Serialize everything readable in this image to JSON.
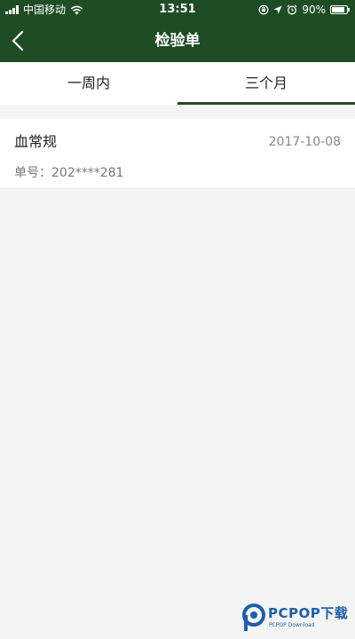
{
  "status_bar": {
    "carrier": "中国移动",
    "time": "13:51",
    "battery_percent": "90%",
    "battery_level": 0.9,
    "icons": [
      "signal-icon",
      "wifi-icon",
      "lock-rotation-icon",
      "location-icon",
      "alarm-icon",
      "battery-icon"
    ]
  },
  "nav": {
    "title": "检验单",
    "back_icon": "back-chevron-icon"
  },
  "tabs": [
    {
      "label": "一周内",
      "active": false
    },
    {
      "label": "三个月",
      "active": true
    }
  ],
  "records": [
    {
      "name": "血常规",
      "date": "2017-10-08",
      "number_label": "单号：",
      "number_value": "202****281"
    }
  ],
  "watermark": {
    "text": "PCPOP下载",
    "sub": "PCPOP Download"
  },
  "colors": {
    "header_bg": "#1e4d25",
    "tab_indicator": "#1e4d25",
    "page_bg": "#f4f4f4",
    "watermark": "#1c5fa8"
  }
}
